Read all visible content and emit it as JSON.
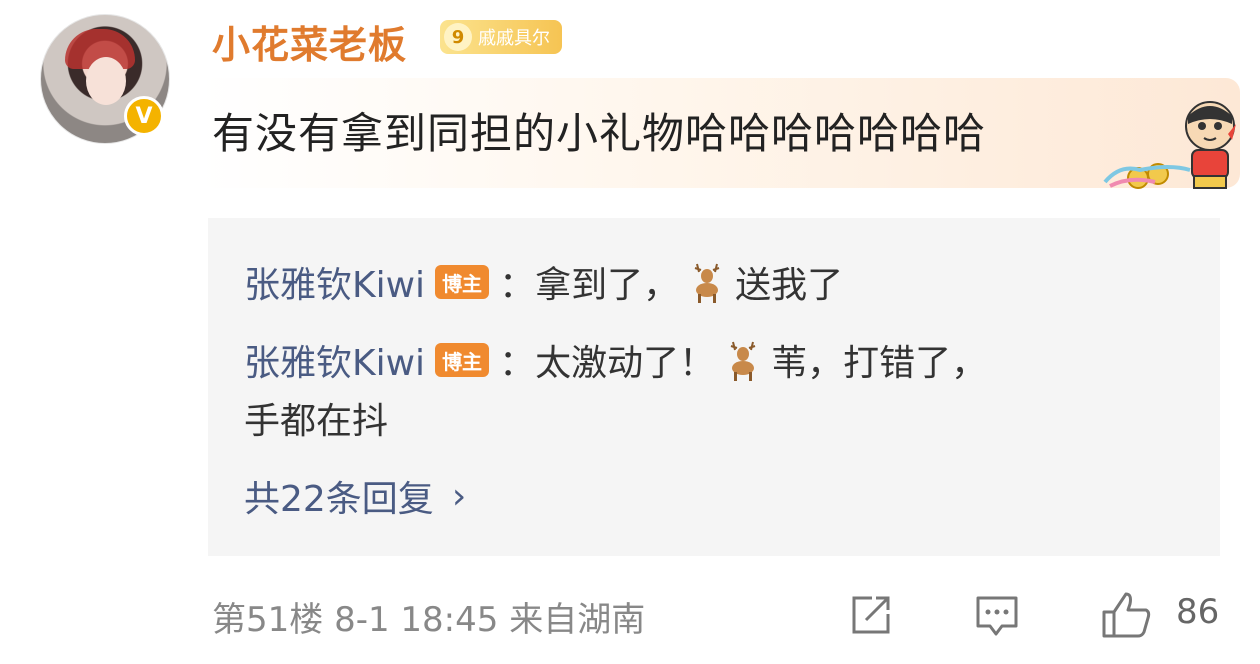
{
  "comment": {
    "user": {
      "name": "小花菜老板",
      "level": "9",
      "level_title": "戚戚具尔",
      "verified_mark": "V"
    },
    "text": "有没有拿到同担的小礼物哈哈哈哈哈哈哈"
  },
  "replies": [
    {
      "author": "张雅钦Kiwi",
      "tag": "博主",
      "text_before": "：拿到了，",
      "text_after": "送我了"
    },
    {
      "author": "张雅钦Kiwi",
      "tag": "博主",
      "text_before": "：太激动了！",
      "text_after": "苇，打错了，",
      "text_cont": "手都在抖"
    }
  ],
  "more_replies": {
    "label": "共22条回复",
    "chevron": "›"
  },
  "footer": {
    "floor": "第51楼",
    "time": "8-1 18:45",
    "location": "来自湖南",
    "like_count": "86"
  },
  "icons": [
    "deer-emoji-icon",
    "share-icon",
    "comment-icon",
    "like-icon",
    "cartoon-sticker"
  ]
}
